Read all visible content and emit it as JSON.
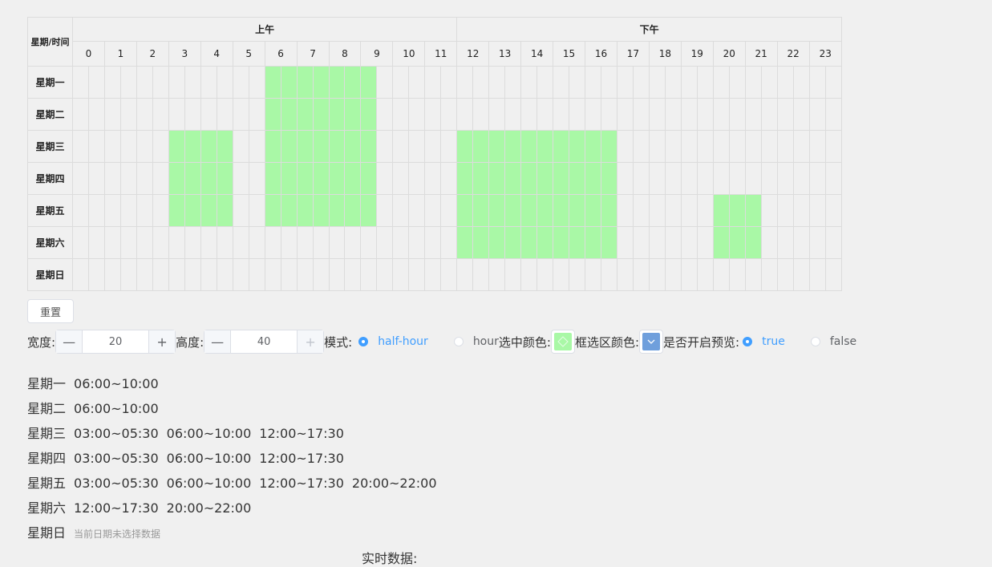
{
  "table": {
    "corner_label": "星期/时间",
    "am_label": "上午",
    "pm_label": "下午",
    "hours": [
      "0",
      "1",
      "2",
      "3",
      "4",
      "5",
      "6",
      "7",
      "8",
      "9",
      "10",
      "11",
      "12",
      "13",
      "14",
      "15",
      "16",
      "17",
      "18",
      "19",
      "20",
      "21",
      "22",
      "23"
    ],
    "days": [
      {
        "label": "星期一",
        "selected_halfhours": [
          [
            12,
            19
          ]
        ]
      },
      {
        "label": "星期二",
        "selected_halfhours": [
          [
            12,
            19
          ]
        ]
      },
      {
        "label": "星期三",
        "selected_halfhours": [
          [
            6,
            10
          ],
          [
            12,
            19
          ],
          [
            24,
            34
          ]
        ]
      },
      {
        "label": "星期四",
        "selected_halfhours": [
          [
            6,
            10
          ],
          [
            12,
            19
          ],
          [
            24,
            34
          ]
        ]
      },
      {
        "label": "星期五",
        "selected_halfhours": [
          [
            6,
            10
          ],
          [
            12,
            19
          ],
          [
            24,
            34
          ],
          [
            40,
            43
          ]
        ]
      },
      {
        "label": "星期六",
        "selected_halfhours": [
          [
            24,
            34
          ],
          [
            40,
            43
          ]
        ]
      },
      {
        "label": "星期日",
        "selected_halfhours": []
      }
    ],
    "selected_color": "#a9f8a6"
  },
  "controls": {
    "reset_label": "重置",
    "width_label": "宽度:",
    "width_value": "20",
    "height_label": "高度:",
    "height_value": "40",
    "minus_symbol": "—",
    "plus_symbol": "+",
    "mode_label": "模式:",
    "mode_options": [
      "half-hour",
      "hour"
    ],
    "mode_selected": "half-hour",
    "selected_color_label": "选中颜色:",
    "selected_color": "#a9f8a6",
    "box_color_label": "框选区颜色:",
    "box_color": "#6f9fdc",
    "preview_label": "是否开启预览:",
    "preview_options": [
      "true",
      "false"
    ],
    "preview_selected": "true"
  },
  "summary": [
    {
      "day": "星期一",
      "ranges": [
        "06:00~10:00"
      ]
    },
    {
      "day": "星期二",
      "ranges": [
        "06:00~10:00"
      ]
    },
    {
      "day": "星期三",
      "ranges": [
        "03:00~05:30",
        "06:00~10:00",
        "12:00~17:30"
      ]
    },
    {
      "day": "星期四",
      "ranges": [
        "03:00~05:30",
        "06:00~10:00",
        "12:00~17:30"
      ]
    },
    {
      "day": "星期五",
      "ranges": [
        "03:00~05:30",
        "06:00~10:00",
        "12:00~17:30",
        "20:00~22:00"
      ]
    },
    {
      "day": "星期六",
      "ranges": [
        "12:00~17:30",
        "20:00~22:00"
      ]
    },
    {
      "day": "星期日",
      "ranges": [],
      "empty_text": "当前日期未选择数据"
    }
  ],
  "realtime_label": "实时数据:"
}
